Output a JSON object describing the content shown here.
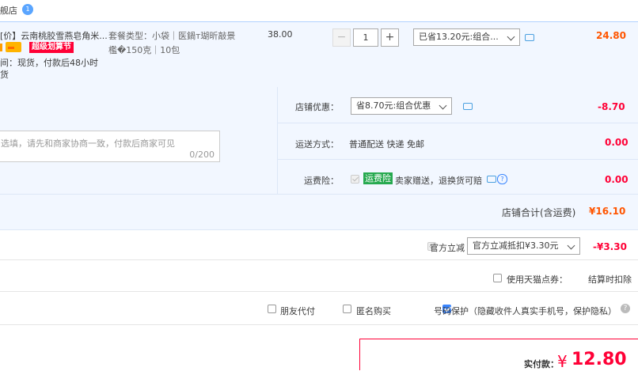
{
  "shop": {
    "name_fragment": "舰店",
    "badge": "1"
  },
  "item": {
    "title": "[价】云南桃胶雪燕皂角米...",
    "promo_badge": "超级划算节",
    "delivery": "间：现货，付款后48小时",
    "delivery_cont": "货",
    "sku_line1": "套餐类型：小袋｜医鍋т瑚昕敲景",
    "sku_line2": "檻�150克｜10包",
    "unit_price": "38.00",
    "qty": "1",
    "qty_minus": "−",
    "qty_plus": "+",
    "discount_select": "已省13.20元:组合...",
    "subtotal": "24.80"
  },
  "order": {
    "message_placeholder": "选填，请先和商家协商一致，付款后商家可见",
    "message_counter": "0/200",
    "shop_discount_label": "店铺优惠：",
    "shop_discount_select": "省8.70元:组合优惠",
    "shop_discount_value": "-8.70",
    "shipping_label": "运送方式：",
    "shipping_method": "普通配送 快递 免邮",
    "shipping_value": "0.00",
    "insurance_label": "运费险：",
    "insurance_tag": "运费险",
    "insurance_text": "卖家赠送，退换货可赔",
    "insurance_value": "0.00",
    "help_icon": "?",
    "shop_total_label": "店铺合计(含运费)",
    "shop_total_value": "¥16.10"
  },
  "official": {
    "label": "官方立减",
    "select": "官方立减抵扣¥3.30元",
    "value": "-¥3.30"
  },
  "points": {
    "label": "使用天猫点券：",
    "note": "结算时扣除"
  },
  "options": {
    "friend_pay": "朋友代付",
    "anonymous": "匿名购买",
    "phone_protect": "号码保护（隐藏收件人真实手机号，保护隐私）",
    "help": "?"
  },
  "payment": {
    "label": "实付款：",
    "currency": "¥",
    "amount": "12.80"
  },
  "colors": {
    "accent_red": "#ff0036",
    "orange": "#ff5500",
    "row_bg": "#f2f7ff",
    "border_blue": "#b2d1ff"
  },
  "icons": [
    "info-badge-icon",
    "chat-icon",
    "chevron-down-icon",
    "checkbox-icon",
    "help-icon",
    "card-icon"
  ]
}
